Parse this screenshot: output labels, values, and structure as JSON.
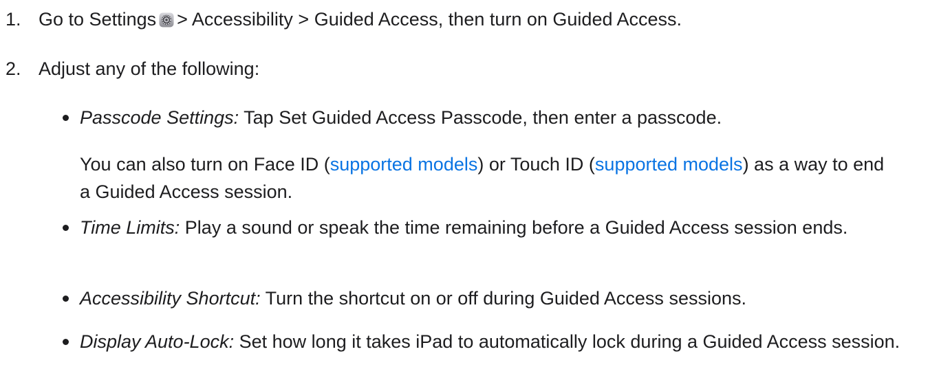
{
  "steps": [
    {
      "number": "1.",
      "prefix": "Go to Settings",
      "icon": "settings-icon",
      "suffix": "> Accessibility > Guided Access, then turn on Guided Access."
    },
    {
      "number": "2.",
      "text": "Adjust any of the following:"
    }
  ],
  "items": [
    {
      "term": "Passcode Settings:",
      "text": "Tap Set Guided Access Passcode, then enter a passcode.",
      "note": {
        "part1": "You can also turn on Face ID (",
        "link1": "supported models",
        "part2": ") or Touch ID (",
        "link2": "supported models",
        "part3": ") as a way to end a Guided Access session."
      }
    },
    {
      "term": "Time Limits:",
      "text": "Play a sound or speak the time remaining before a Guided Access session ends."
    },
    {
      "term": "Accessibility Shortcut:",
      "text": "Turn the shortcut on or off during Guided Access sessions."
    },
    {
      "term": "Display Auto-Lock:",
      "text": "Set how long it takes iPad to automatically lock during a Guided Access session."
    }
  ],
  "colors": {
    "text": "#1d1d1f",
    "link": "#0a74e3"
  }
}
